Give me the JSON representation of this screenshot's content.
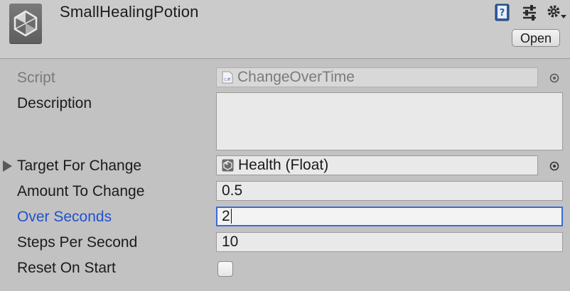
{
  "header": {
    "asset_name": "SmallHealingPotion",
    "open_button_label": "Open",
    "icons": [
      "help-book-icon",
      "preset-sliders-icon",
      "gear-dropdown-icon"
    ]
  },
  "fields": {
    "script": {
      "label": "Script",
      "value": "ChangeOverTime",
      "icon": "csharp-script-icon"
    },
    "description": {
      "label": "Description",
      "value": ""
    },
    "target_for_change": {
      "label": "Target For Change",
      "value": "Health (Float)",
      "icon": "unity-asset-icon"
    },
    "amount_to_change": {
      "label": "Amount To Change",
      "value": "0.5"
    },
    "over_seconds": {
      "label": "Over Seconds",
      "value": "2"
    },
    "steps_per_second": {
      "label": "Steps Per Second",
      "value": "10"
    },
    "reset_on_start": {
      "label": "Reset On Start",
      "checked": false
    }
  },
  "colors": {
    "panel_bg": "#c2c2c2",
    "header_bg": "#cbcbcb",
    "focused_label": "#2151d0",
    "focus_ring": "#3a6bd9"
  }
}
